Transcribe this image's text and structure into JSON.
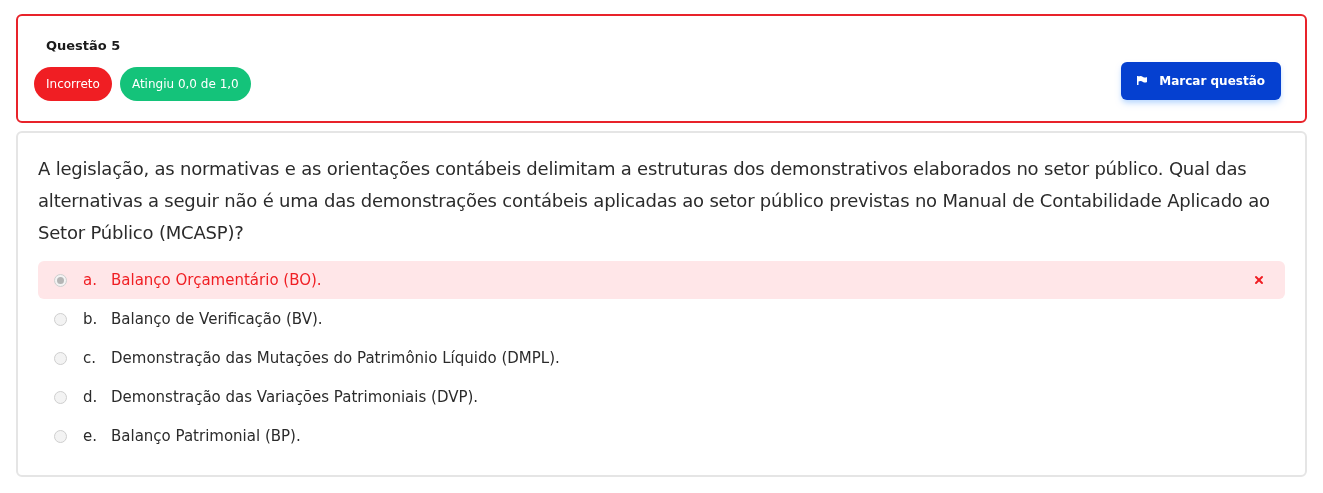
{
  "header": {
    "title": "Questão 5",
    "badges": [
      {
        "label": "Incorreto",
        "color": "#f01e23"
      },
      {
        "label": "Atingiu 0,0 de 1,0",
        "color": "#14c37a"
      }
    ],
    "flag_button": {
      "label": "Marcar questão"
    }
  },
  "question": {
    "text": "A legislação, as normativas e as orientações contábeis delimitam a estruturas dos demonstrativos elaborados no setor público. Qual das alternativas a seguir não é uma das demonstrações contábeis aplicadas ao setor público previstas no Manual de Contabilidade Aplicado ao Setor Público (MCASP)?",
    "options": [
      {
        "letter": "a.",
        "text": "Balanço Orçamentário (BO).",
        "selected": true,
        "incorrect": true
      },
      {
        "letter": "b.",
        "text": "Balanço de Verificação (BV).",
        "selected": false,
        "incorrect": false
      },
      {
        "letter": "c.",
        "text": "Demonstração das Mutações do Patrimônio Líquido (DMPL).",
        "selected": false,
        "incorrect": false
      },
      {
        "letter": "d.",
        "text": "Demonstração das Variações Patrimoniais (DVP).",
        "selected": false,
        "incorrect": false
      },
      {
        "letter": "e.",
        "text": "Balanço Patrimonial (BP).",
        "selected": false,
        "incorrect": false
      }
    ]
  }
}
